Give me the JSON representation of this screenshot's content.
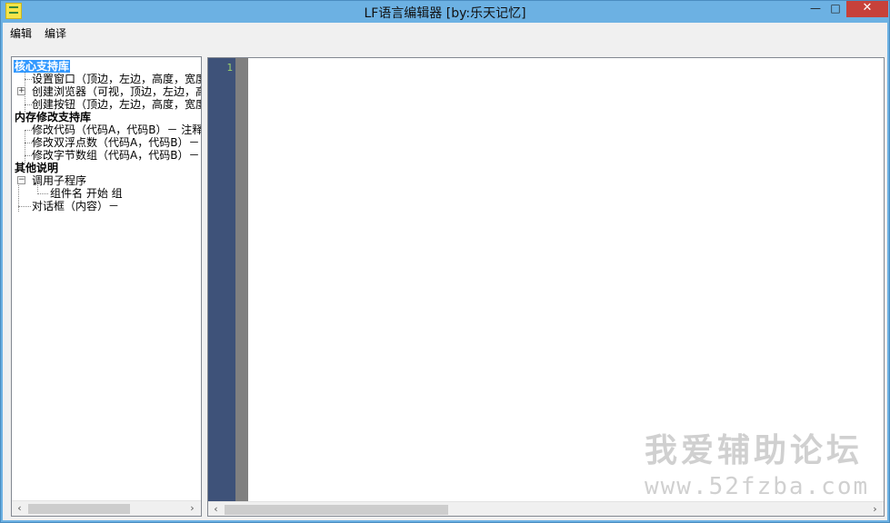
{
  "window": {
    "title": "LF语言编辑器 [by:乐天记忆]",
    "controls": {
      "minimize": "—",
      "maximize": "□",
      "close": "✕"
    }
  },
  "menu": {
    "items": [
      "编辑",
      "编译"
    ]
  },
  "tree": {
    "rows": [
      {
        "label": "核心支持库",
        "bold": true,
        "selected": true
      },
      {
        "label": "设置窗口（顶边，左边，高度，宽度"
      },
      {
        "label": "创建浏览器（可视，顶边，左边，高"
      },
      {
        "label": "创建按钮（顶边，左边，高度，宽度"
      },
      {
        "label": "内存修改支持库",
        "bold": true
      },
      {
        "label": "修改代码（代码A，代码B）－  注释"
      },
      {
        "label": "修改双浮点数（代码A，代码B）－"
      },
      {
        "label": "修改字节数组（代码A，代码B）－ 注"
      },
      {
        "label": "其他说明",
        "bold": true
      },
      {
        "label": "调用子程序"
      },
      {
        "label": "组件名 开始                   组"
      },
      {
        "label": "对话框（内容）－"
      }
    ]
  },
  "editor": {
    "line_numbers": [
      "1"
    ],
    "content": ""
  },
  "watermark": {
    "line1": "我爱辅助论坛",
    "line2": "www.52fzba.com"
  },
  "icons": {
    "app": "app-icon",
    "expand": "plus-box-icon",
    "collapse": "minus-box-icon",
    "scroll_left": "chevron-left-icon",
    "scroll_right": "chevron-right-icon"
  },
  "colors": {
    "titlebar": "#6cb1e3",
    "gutter": "#3e5279",
    "close_button": "#c7413a",
    "selection": "#3399ff"
  }
}
